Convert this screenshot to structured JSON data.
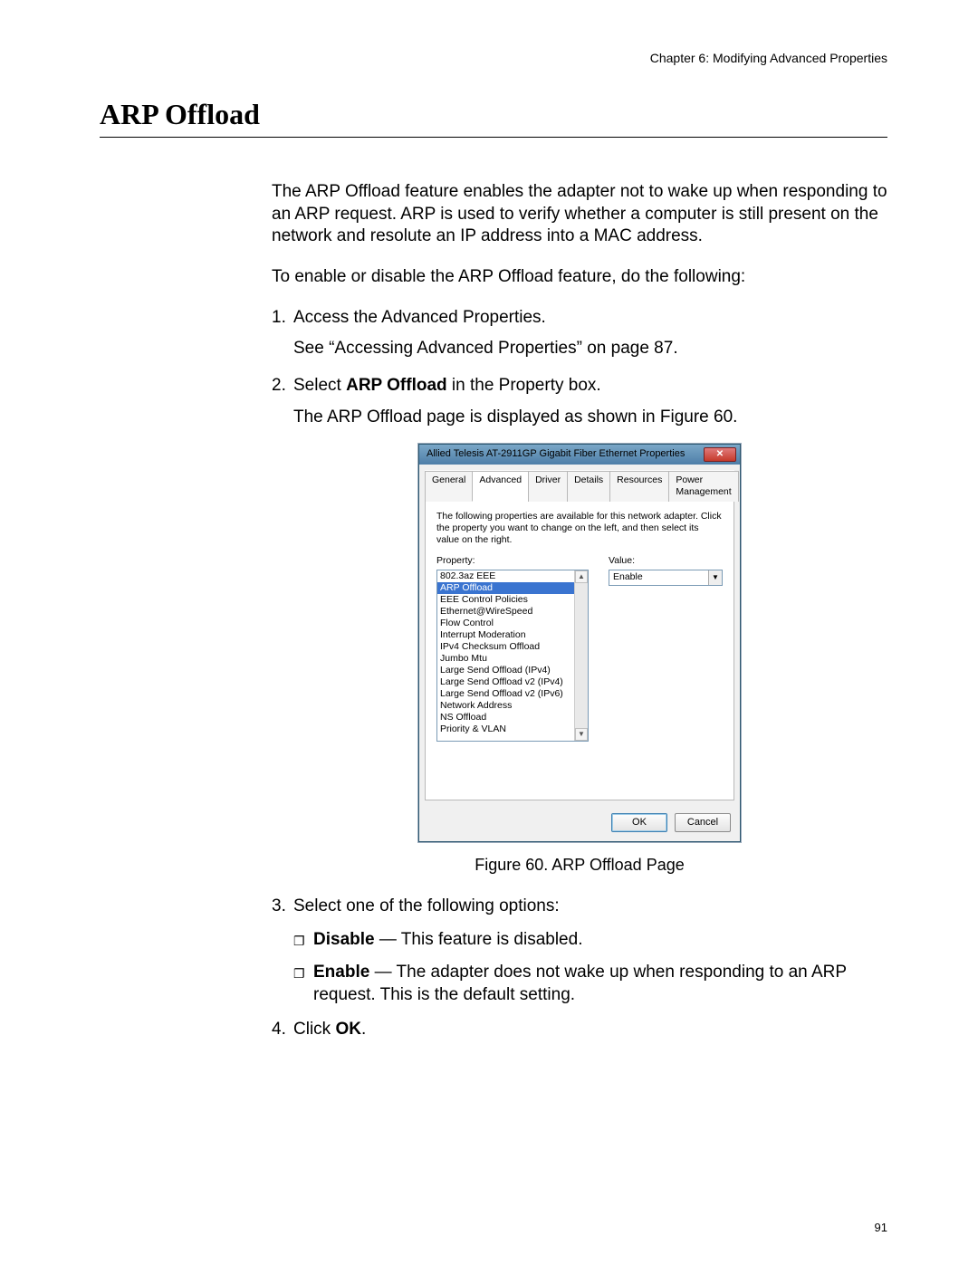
{
  "chapter": "Chapter 6: Modifying Advanced Properties",
  "heading": "ARP Offload",
  "intro": "The ARP Offload feature enables the adapter not to wake up when responding to an ARP request. ARP is used to verify whether a computer is still present on the network and resolute an IP address into a MAC address.",
  "lead": "To enable or disable the ARP Offload feature, do the following:",
  "steps": {
    "s1": "Access the Advanced Properties.",
    "s1b": "See “Accessing Advanced Properties” on page 87.",
    "s2a": "Select ",
    "s2b": "ARP Offload",
    "s2c": " in the Property box.",
    "s2d": "The ARP Offload page is displayed as shown in Figure 60.",
    "s3": "Select one of the following options:",
    "s4a": "Click ",
    "s4b": "OK",
    "s4c": "."
  },
  "options": {
    "o1a": "Disable",
    "o1b": " — This feature is disabled.",
    "o2a": "Enable",
    "o2b": " — The adapter does not wake up when responding to an ARP request. This is the default setting."
  },
  "figure_caption": "Figure 60. ARP Offload Page",
  "dialog": {
    "title": "Allied Telesis AT-2911GP Gigabit Fiber Ethernet Properties",
    "tabs": [
      "General",
      "Advanced",
      "Driver",
      "Details",
      "Resources",
      "Power Management"
    ],
    "active_tab": "Advanced",
    "instructions": "The following properties are available for this network adapter. Click the property you want to change on the left, and then select its value on the right.",
    "property_label": "Property:",
    "value_label": "Value:",
    "properties": [
      "802.3az EEE",
      "ARP Offload",
      "EEE Control Policies",
      "Ethernet@WireSpeed",
      "Flow Control",
      "Interrupt Moderation",
      "IPv4 Checksum Offload",
      "Jumbo Mtu",
      "Large Send Offload (IPv4)",
      "Large Send Offload v2 (IPv4)",
      "Large Send Offload v2 (IPv6)",
      "Network Address",
      "NS Offload",
      "Priority & VLAN"
    ],
    "selected_property": "ARP Offload",
    "value": "Enable",
    "ok": "OK",
    "cancel": "Cancel"
  },
  "page_number": "91"
}
